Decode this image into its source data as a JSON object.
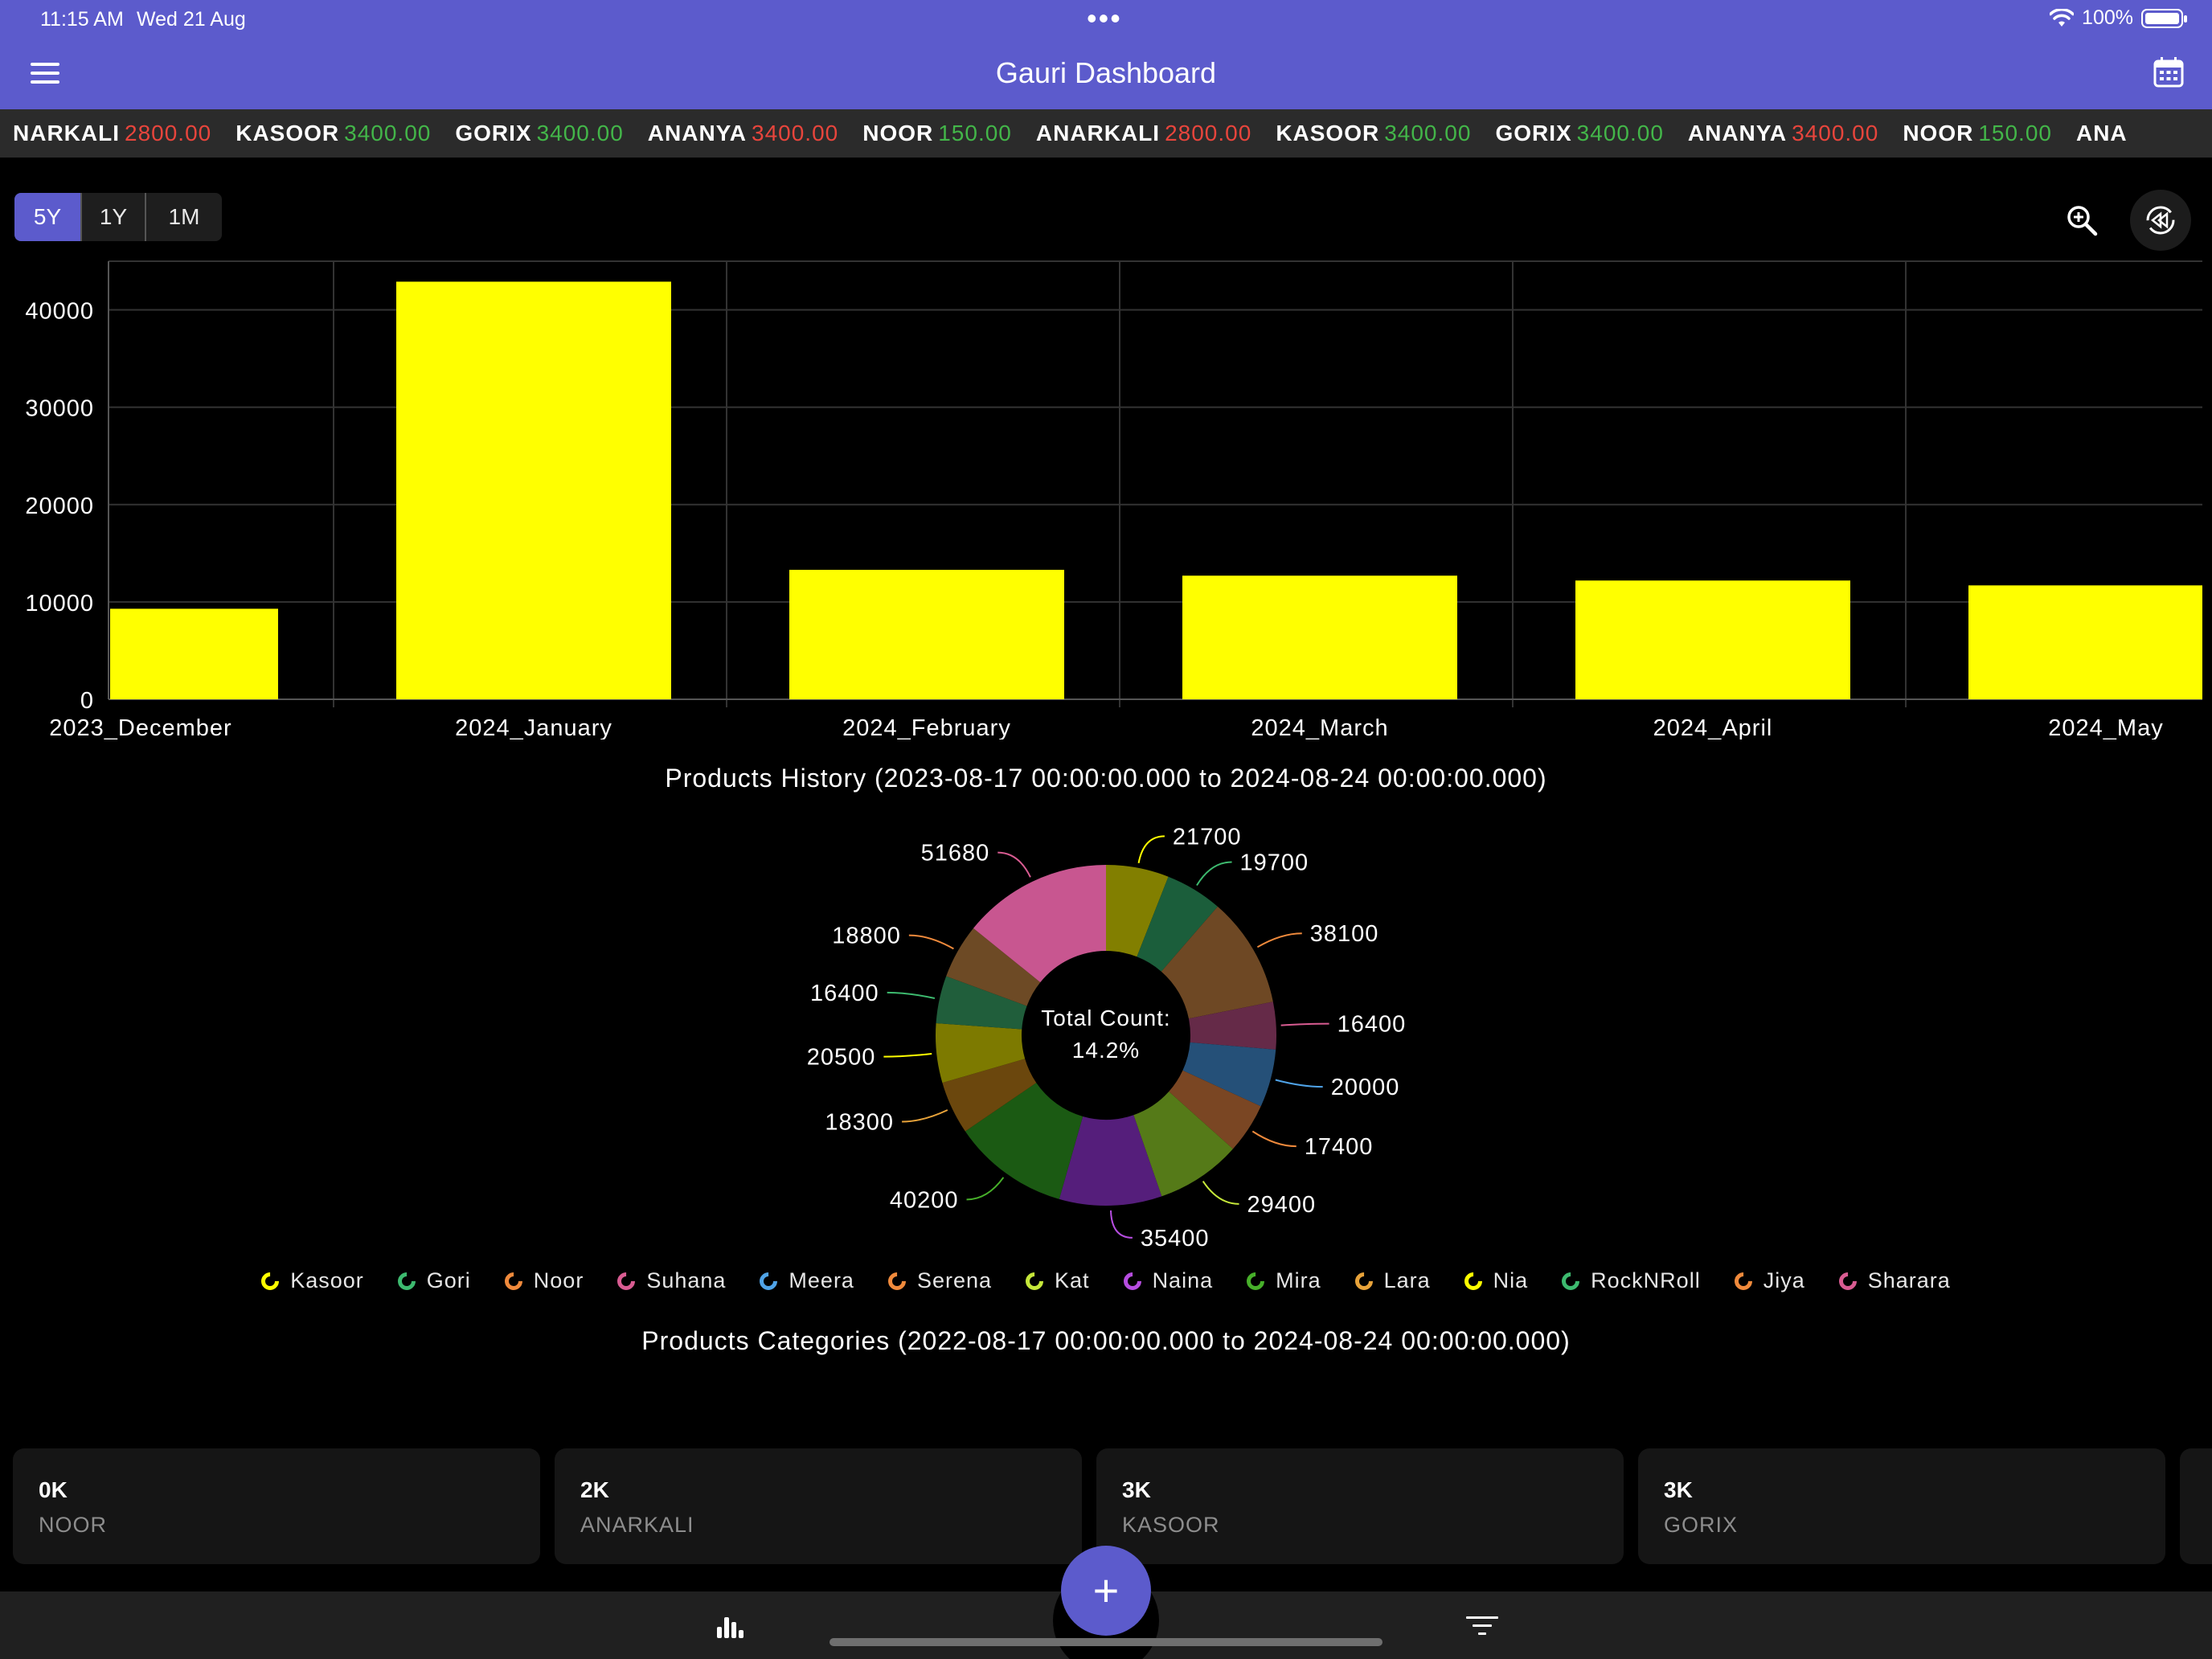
{
  "status_bar": {
    "time": "11:15 AM",
    "date": "Wed 21 Aug",
    "dots": "•••",
    "battery": "100%"
  },
  "app_bar": {
    "title": "Gauri Dashboard"
  },
  "ticker": [
    {
      "name": "NARKALI",
      "value": "2800.00",
      "color": "red"
    },
    {
      "name": "KASOOR",
      "value": "3400.00",
      "color": "green"
    },
    {
      "name": "GORIX",
      "value": "3400.00",
      "color": "green"
    },
    {
      "name": "ANANYA",
      "value": "3400.00",
      "color": "red"
    },
    {
      "name": "NOOR",
      "value": "150.00",
      "color": "green"
    },
    {
      "name": "ANARKALI",
      "value": "2800.00",
      "color": "red"
    },
    {
      "name": "KASOOR",
      "value": "3400.00",
      "color": "green"
    },
    {
      "name": "GORIX",
      "value": "3400.00",
      "color": "green"
    },
    {
      "name": "ANANYA",
      "value": "3400.00",
      "color": "red"
    },
    {
      "name": "NOOR",
      "value": "150.00",
      "color": "green"
    },
    {
      "name": "ANA",
      "value": "",
      "color": "red"
    }
  ],
  "range_buttons": [
    {
      "label": "5Y",
      "active": true
    },
    {
      "label": "1Y",
      "active": false
    },
    {
      "label": "1M",
      "active": false
    }
  ],
  "chart_data": [
    {
      "type": "bar",
      "title": "Products History (2023-08-17 00:00:00.000 to 2024-08-24 00:00:00.000)",
      "categories": [
        "2023_December",
        "2024_January",
        "2024_February",
        "2024_March",
        "2024_April",
        "2024_May"
      ],
      "values": [
        9300,
        42900,
        13300,
        12700,
        12200,
        11700
      ],
      "ylim": [
        0,
        45000
      ],
      "yticks": [
        0,
        10000,
        20000,
        30000,
        40000
      ],
      "bar_color": "#ffff00",
      "grid": true
    },
    {
      "type": "pie",
      "style": "donut",
      "title": "Products Categories (2022-08-17 00:00:00.000 to 2024-08-24 00:00:00.000)",
      "center_label_line1": "Total Count:",
      "center_label_line2": "14.2%",
      "labels": [
        "Kasoor",
        "Gori",
        "Noor",
        "Suhana",
        "Meera",
        "Serena",
        "Kat",
        "Naina",
        "Mira",
        "Lara",
        "Nia",
        "RockNRoll",
        "Jiya",
        "Sharara"
      ],
      "values": [
        21700,
        19700,
        38100,
        16400,
        20000,
        17400,
        29400,
        35400,
        40200,
        18300,
        20500,
        16400,
        18800,
        51680
      ],
      "slice_colors": [
        "#827f00",
        "#1b5e3b",
        "#6e4824",
        "#652a48",
        "#255078",
        "#7a4623",
        "#557a18",
        "#551e7b",
        "#1b5a13",
        "#6b470d",
        "#7d7a00",
        "#205e3b",
        "#6d4a25",
        "#c85690"
      ],
      "legend_colors": [
        "#ffff00",
        "#3dba6f",
        "#f08a3c",
        "#d95c92",
        "#4fa3e8",
        "#f08a3c",
        "#c6e83a",
        "#b64de0",
        "#47b02a",
        "#e8a33a",
        "#ffff00",
        "#3dba6f",
        "#f08a3c",
        "#d95c92"
      ]
    }
  ],
  "stat_cards": [
    {
      "value": "0K",
      "label": "NOOR"
    },
    {
      "value": "2K",
      "label": "ANARKALI"
    },
    {
      "value": "3K",
      "label": "KASOOR"
    },
    {
      "value": "3K",
      "label": "GORIX"
    }
  ],
  "fab": {
    "label": "+"
  },
  "colors": {
    "accent": "#5c5bcc",
    "ticker_red": "#e8453c",
    "ticker_green": "#43b649",
    "bar": "#ffff00"
  },
  "icons": {
    "menu": "menu-icon",
    "calendar": "calendar-icon",
    "zoom": "zoom-in-icon",
    "reset": "reset-zoom-icon",
    "chart_nav": "bar-chart-icon",
    "filter_nav": "filter-icon",
    "wifi": "wifi-icon",
    "battery": "battery-icon"
  }
}
